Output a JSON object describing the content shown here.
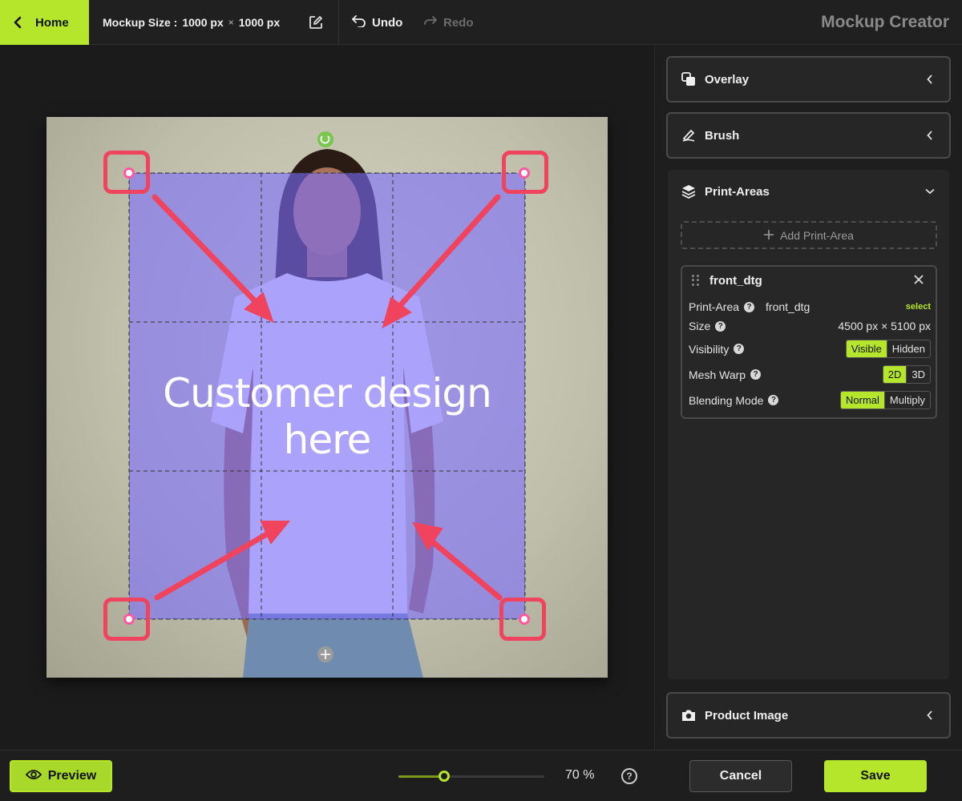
{
  "topbar": {
    "home_label": "Home",
    "mockup_size_label": "Mockup Size :",
    "width": "1000 px",
    "times": "×",
    "height": "1000 px",
    "undo_label": "Undo",
    "redo_label": "Redo",
    "app_title": "Mockup Creator"
  },
  "canvas": {
    "design_placeholder": "Customer design here"
  },
  "sidebar": {
    "overlay_label": "Overlay",
    "brush_label": "Brush",
    "print_areas_label": "Print-Areas",
    "add_print_area_label": "Add Print-Area",
    "product_image_label": "Product Image",
    "card": {
      "title": "front_dtg",
      "print_area_label": "Print-Area",
      "print_area_value": "front_dtg",
      "select_label": "select",
      "size_label": "Size",
      "size_value": "4500 px × 5100 px",
      "visibility_label": "Visibility",
      "visibility_options": [
        "Visible",
        "Hidden"
      ],
      "visibility_selected": "Visible",
      "mesh_warp_label": "Mesh Warp",
      "mesh_warp_options": [
        "2D",
        "3D"
      ],
      "mesh_warp_selected": "2D",
      "blending_label": "Blending Mode",
      "blending_options": [
        "Normal",
        "Multiply"
      ],
      "blending_selected": "Normal"
    }
  },
  "bottombar": {
    "preview_label": "Preview",
    "zoom_level": 70,
    "zoom_text": "70 %",
    "help_glyph": "?",
    "cancel_label": "Cancel",
    "save_label": "Save"
  },
  "colors": {
    "accent": "#b5e62b",
    "print_area_overlay": "#7b6cff",
    "annotation_red": "#f0445e",
    "handle_pink": "#ff5aa0"
  }
}
